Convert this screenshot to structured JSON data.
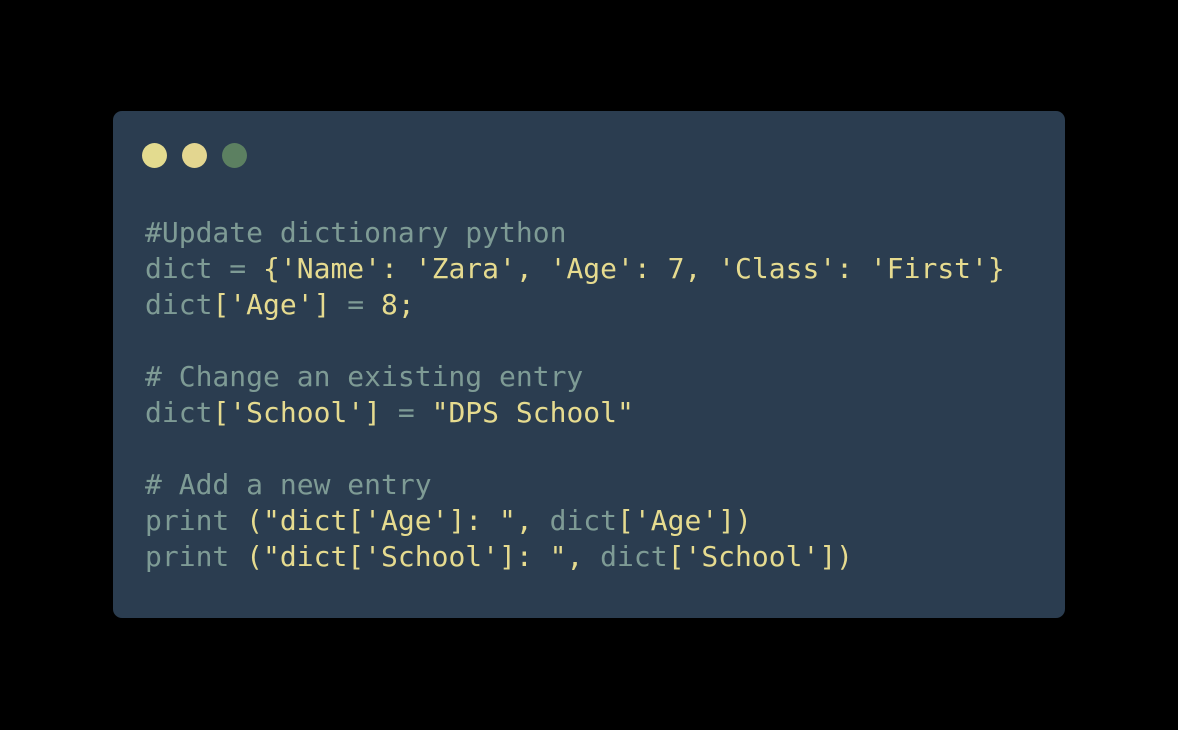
{
  "window": {
    "background": "#2b3d50",
    "controls": [
      {
        "name": "close-dot",
        "color": "#e3db8f"
      },
      {
        "name": "minimize-dot",
        "color": "#e3d690"
      },
      {
        "name": "maximize-dot",
        "color": "#5c8061"
      }
    ]
  },
  "colors": {
    "comment": "#7e9b95",
    "identifier": "#7e9b95",
    "text": "#e6db8f",
    "page_background": "#000000"
  },
  "code": {
    "language": "python",
    "lines": [
      {
        "tokens": [
          {
            "t": "#Update dictionary python",
            "k": "comment"
          }
        ]
      },
      {
        "tokens": [
          {
            "t": "dict",
            "k": "ident"
          },
          {
            "t": " = ",
            "k": "ident"
          },
          {
            "t": "{'Name': 'Zara', 'Age': 7, 'Class': 'First'}",
            "k": "plain"
          }
        ]
      },
      {
        "tokens": [
          {
            "t": "dict",
            "k": "ident"
          },
          {
            "t": "['Age'] ",
            "k": "plain"
          },
          {
            "t": "= ",
            "k": "ident"
          },
          {
            "t": "8;",
            "k": "plain"
          }
        ]
      },
      {
        "tokens": []
      },
      {
        "tokens": [
          {
            "t": "# Change an existing entry",
            "k": "comment"
          }
        ]
      },
      {
        "tokens": [
          {
            "t": "dict",
            "k": "ident"
          },
          {
            "t": "['School'] ",
            "k": "plain"
          },
          {
            "t": "= ",
            "k": "ident"
          },
          {
            "t": "\"DPS School\"",
            "k": "plain"
          }
        ]
      },
      {
        "tokens": []
      },
      {
        "tokens": [
          {
            "t": "# Add a new entry",
            "k": "comment"
          }
        ]
      },
      {
        "tokens": [
          {
            "t": "print",
            "k": "ident"
          },
          {
            "t": " (\"dict['Age']: \", ",
            "k": "plain"
          },
          {
            "t": "dict",
            "k": "ident"
          },
          {
            "t": "['Age'])",
            "k": "plain"
          }
        ]
      },
      {
        "tokens": [
          {
            "t": "print",
            "k": "ident"
          },
          {
            "t": " (\"dict['School']: \", ",
            "k": "plain"
          },
          {
            "t": "dict",
            "k": "ident"
          },
          {
            "t": "['School'])",
            "k": "plain"
          }
        ]
      }
    ]
  }
}
